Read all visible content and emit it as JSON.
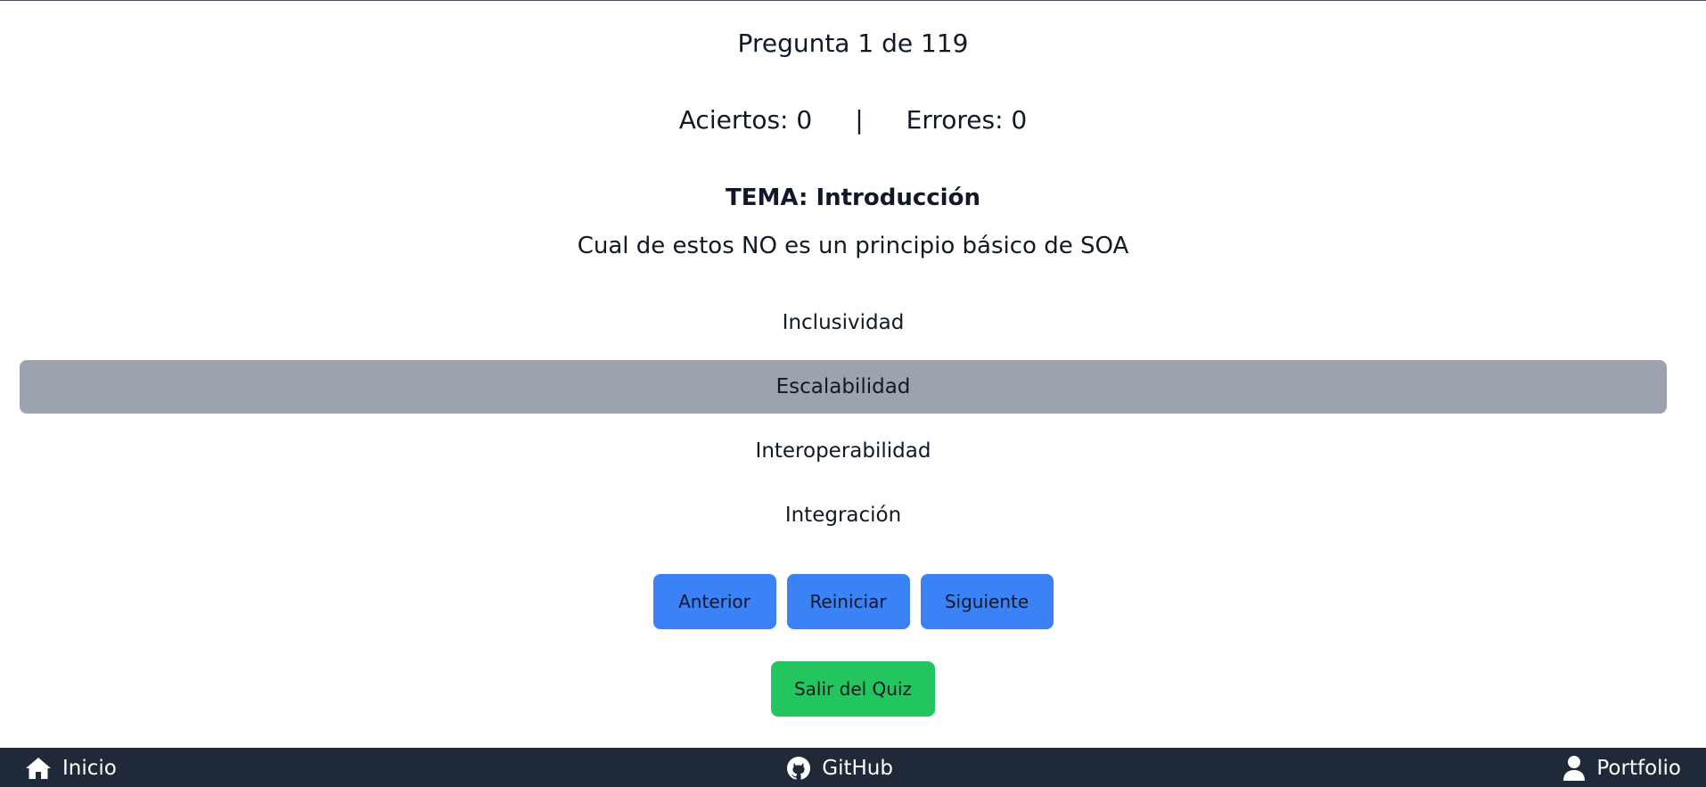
{
  "quiz": {
    "counter": "Pregunta 1 de 119",
    "score": {
      "correct_label": "Aciertos: 0",
      "separator": "|",
      "errors_label": "Errores: 0"
    },
    "topic": "TEMA: Introducción",
    "question": "Cual de estos NO es un principio básico de SOA",
    "options": [
      {
        "label": "Inclusividad",
        "selected": false
      },
      {
        "label": "Escalabilidad",
        "selected": true
      },
      {
        "label": "Interoperabilidad",
        "selected": false
      },
      {
        "label": "Integración",
        "selected": false
      }
    ],
    "buttons": {
      "previous": "Anterior",
      "restart": "Reiniciar",
      "next": "Siguiente",
      "exit": "Salir del Quiz"
    }
  },
  "footer": {
    "home": {
      "label": "Inicio",
      "icon": "home-icon"
    },
    "github": {
      "label": "GitHub",
      "icon": "github-icon"
    },
    "portfolio": {
      "label": "Portfolio",
      "icon": "user-icon"
    }
  },
  "colors": {
    "primary_button": "#3b82f6",
    "exit_button": "#22c55e",
    "selected_option": "#9ca3af",
    "footer_bg": "#1f2937"
  }
}
